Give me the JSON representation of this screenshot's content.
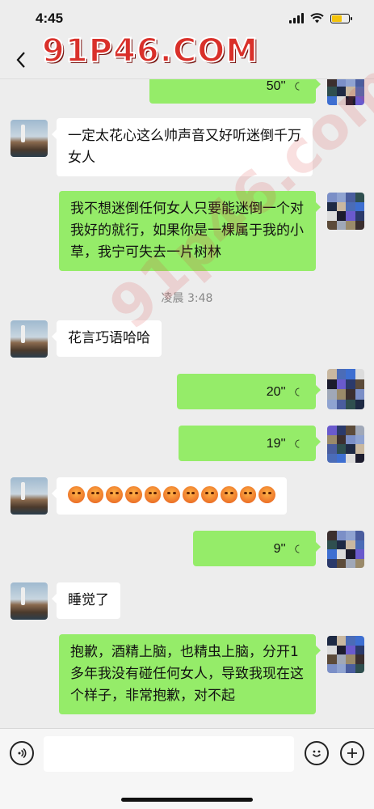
{
  "status": {
    "time": "4:45",
    "battery_level": 0.6
  },
  "watermark": {
    "text": "91P46.COM",
    "diagonal": "91p46.com"
  },
  "timestamp": "凌晨 3:48",
  "messages": [
    {
      "side": "right",
      "type": "voice",
      "duration": "50''"
    },
    {
      "side": "left",
      "type": "text",
      "text": "一定太花心这么帅声音又好听迷倒千万女人"
    },
    {
      "side": "right",
      "type": "text",
      "text": "我不想迷倒任何女人只要能迷倒一个对我好的就行，如果你是一棵属于我的小草，我宁可失去一片树林"
    },
    {
      "side": "left",
      "type": "text",
      "text": "花言巧语哈哈"
    },
    {
      "side": "right",
      "type": "voice",
      "duration": "20''"
    },
    {
      "side": "right",
      "type": "voice",
      "duration": "19''"
    },
    {
      "side": "left",
      "type": "emoji",
      "count": 11
    },
    {
      "side": "right",
      "type": "voice",
      "duration": "9''"
    },
    {
      "side": "left",
      "type": "text",
      "text": "睡觉了"
    },
    {
      "side": "right",
      "type": "text",
      "text": "抱歉，酒精上脑，也精虫上脑，分开1多年我没有碰任何女人，导致我现在这个样子，非常抱歉，对不起"
    }
  ],
  "colors": {
    "bg": "#ededed",
    "sent_bubble": "#95ec69",
    "recv_bubble": "#ffffff"
  },
  "icons": [
    "back-icon",
    "voice-icon",
    "emoji-face-icon",
    "plus-icon"
  ]
}
